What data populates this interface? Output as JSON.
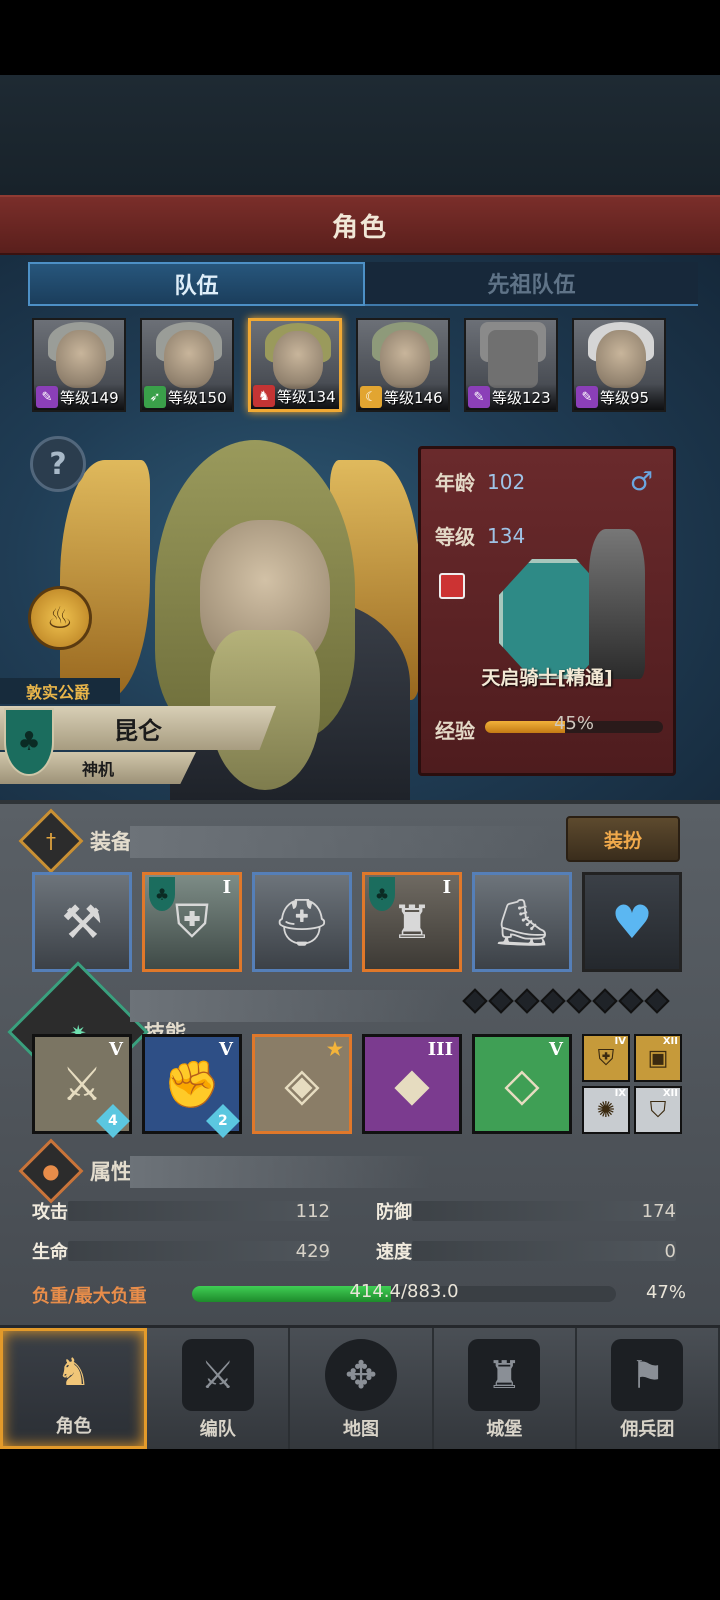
{
  "header": {
    "title": "角色"
  },
  "tabs": [
    {
      "label": "队伍",
      "active": true
    },
    {
      "label": "先祖队伍",
      "active": false
    }
  ],
  "party": [
    {
      "level_text": "等级149",
      "class_color": "#8b3fb8",
      "selected": false
    },
    {
      "level_text": "等级150",
      "class_color": "#3aa04a",
      "selected": false
    },
    {
      "level_text": "等级134",
      "class_color": "#c43434",
      "selected": true
    },
    {
      "level_text": "等级146",
      "class_color": "#e2a531",
      "selected": false
    },
    {
      "level_text": "等级123",
      "class_color": "#8b3fb8",
      "selected": false
    },
    {
      "level_text": "等级95",
      "class_color": "#8b3fb8",
      "selected": false
    }
  ],
  "hero": {
    "title": "敦实公爵",
    "name": "昆仑",
    "subtitle": "神机"
  },
  "info": {
    "age_label": "年龄",
    "age_value": "102",
    "gender_icon": "male-icon",
    "level_label": "等级",
    "level_value": "134",
    "unit_name": "天启骑士[精通]",
    "exp_label": "经验",
    "exp_percent": 45,
    "exp_text": "45%"
  },
  "equipment": {
    "title": "装备",
    "dress_button": "装扮",
    "slots": [
      {
        "name": "mace-icon",
        "tier": "",
        "frame": "blue"
      },
      {
        "name": "shield-icon",
        "tier": "I",
        "frame": "orange"
      },
      {
        "name": "helmet-icon",
        "tier": "",
        "frame": "blue"
      },
      {
        "name": "armor-icon",
        "tier": "I",
        "frame": "orange"
      },
      {
        "name": "boots-icon",
        "tier": "",
        "frame": "blue"
      },
      {
        "name": "amulet-icon",
        "tier": "",
        "frame": "dark"
      }
    ]
  },
  "skills": {
    "title": "技能",
    "pips": 8,
    "items": [
      {
        "name": "sword-strike-skill-icon",
        "tier": "V",
        "badge": "4",
        "bg": "#7b7563"
      },
      {
        "name": "shield-bash-skill-icon",
        "tier": "V",
        "badge": "2",
        "bg": "#2e4f86"
      },
      {
        "name": "crystal-skill-icon",
        "tier": "★",
        "badge": "",
        "bg": "#8a7d67"
      },
      {
        "name": "crystal-power-skill-icon",
        "tier": "III",
        "badge": "",
        "bg": "#7b3b8f"
      },
      {
        "name": "crystal-heal-skill-icon",
        "tier": "V",
        "badge": "",
        "bg": "#3f9f55"
      }
    ],
    "passives": [
      {
        "name": "shield-passive-icon",
        "tier": "IV",
        "bg": "#c69a3a"
      },
      {
        "name": "block-passive-icon",
        "tier": "XII",
        "bg": "#c69a3a"
      },
      {
        "name": "burst-passive-icon",
        "tier": "IX",
        "bg": "#c8ccd0"
      },
      {
        "name": "shield-plus-passive-icon",
        "tier": "XII",
        "bg": "#c8ccd0"
      }
    ]
  },
  "attributes": {
    "title": "属性",
    "stats": [
      {
        "label": "攻击",
        "value": "112"
      },
      {
        "label": "防御",
        "value": "174"
      },
      {
        "label": "生命",
        "value": "429"
      },
      {
        "label": "速度",
        "value": "0"
      }
    ],
    "load_label": "负重/最大负重",
    "load_text": "414.4/883.0",
    "load_percent": 47,
    "load_pct_text": "47%"
  },
  "nav": [
    {
      "label": "角色",
      "active": true,
      "icon": "knight-icon"
    },
    {
      "label": "编队",
      "active": false,
      "icon": "formation-icon"
    },
    {
      "label": "地图",
      "active": false,
      "icon": "map-compass-icon"
    },
    {
      "label": "城堡",
      "active": false,
      "icon": "castle-icon"
    },
    {
      "label": "佣兵团",
      "active": false,
      "icon": "mercenary-icon"
    }
  ]
}
